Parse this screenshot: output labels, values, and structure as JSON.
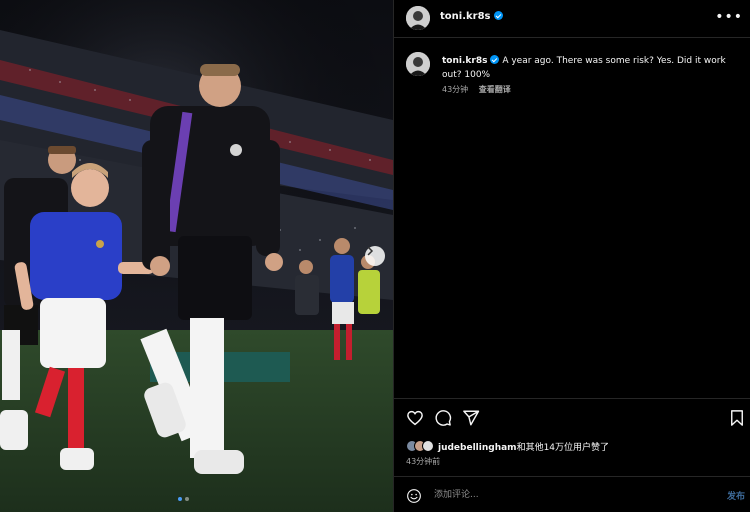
{
  "post": {
    "username": "toni.kr8s",
    "caption": "A year ago. There was some risk? Yes. Did it work out? 100%",
    "caption_time": "43分钟",
    "translate_label": "查看翻译",
    "likes_user": "judebellingham",
    "likes_suffix": "和其他14万位用户赞了",
    "post_time": "43分钟前",
    "comment_placeholder": "添加评论...",
    "post_button": "发布"
  },
  "carousel": {
    "total": 2,
    "current": 1
  },
  "colors": {
    "background": "#000000",
    "verified": "#0095f6",
    "carousel_dot_active": "#4a9bf5",
    "post_button": "#3d6a99"
  },
  "icons": [
    "more-icon",
    "heart-icon",
    "comment-icon",
    "share-icon",
    "bookmark-icon",
    "emoji-icon",
    "chevron-right-icon",
    "verified-icon"
  ]
}
